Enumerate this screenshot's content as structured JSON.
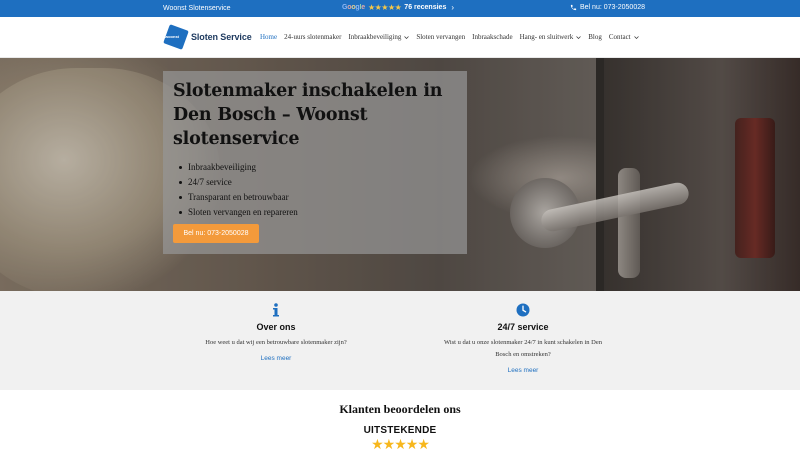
{
  "topbar": {
    "site_name": "Woonst Slotenservice",
    "google_word": [
      "G",
      "o",
      "o",
      "g",
      "l",
      "e"
    ],
    "review_stars": "★★★★★",
    "review_count": "76 recensies",
    "phone": "Bel nu: 073-2050028"
  },
  "header": {
    "logo_text": "Sloten Service",
    "logo_mark_text": "woonst",
    "nav": [
      {
        "label": "Home",
        "active": true,
        "dropdown": false
      },
      {
        "label": "24-uurs slotenmaker",
        "active": false,
        "dropdown": false
      },
      {
        "label": "Inbraakbeveiliging",
        "active": false,
        "dropdown": true
      },
      {
        "label": "Sloten vervangen",
        "active": false,
        "dropdown": false
      },
      {
        "label": "Inbraakschade",
        "active": false,
        "dropdown": false
      },
      {
        "label": "Hang- en sluitwerk",
        "active": false,
        "dropdown": true
      },
      {
        "label": "Blog",
        "active": false,
        "dropdown": false
      },
      {
        "label": "Contact",
        "active": false,
        "dropdown": true
      }
    ]
  },
  "hero": {
    "title": "Slotenmaker inschakelen in Den Bosch – Woonst slotenservice",
    "bullets": [
      "Inbraakbeveiliging",
      "24/7 service",
      "Transparant en betrouwbaar",
      "Sloten vervangen en repareren"
    ],
    "cta_label": "Bel nu: 073-2050028"
  },
  "features": [
    {
      "icon": "info-icon",
      "title": "Over ons",
      "text": "Hoe weet u dat wij een betrouwbare slotenmaker zijn?",
      "link": "Lees meer"
    },
    {
      "icon": "clock-icon",
      "title": "24/7 service",
      "text": "Wist u dat u onze slotenmaker 24/7 in kunt schakelen in Den Bosch en omstreken?",
      "link": "Lees meer"
    }
  ],
  "reviews": {
    "heading": "Klanten beoordelen ons",
    "rating_label": "UITSTEKENDE",
    "stars": "★★★★★"
  },
  "colors": {
    "brand_blue": "#1e6fc0",
    "cta_orange": "#f39a3b",
    "star_gold": "#f7b71d"
  }
}
